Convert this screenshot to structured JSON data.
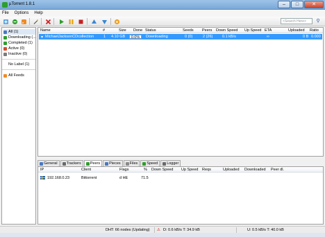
{
  "window": {
    "title": "µTorrent 1.8.1",
    "minimize": "–",
    "maximize": "□",
    "close": "✕"
  },
  "menu": [
    "File",
    "Options",
    "Help"
  ],
  "search": {
    "placeholder": "<Search Here>",
    "button": "⚲"
  },
  "sidebar": {
    "categories": [
      {
        "label": "All (1)",
        "color": "#4a78c2"
      },
      {
        "label": "Downloading (...",
        "color": "#2e9e2e"
      },
      {
        "label": "Completed (1)",
        "color": "#2e9e2e"
      },
      {
        "label": "Active (0)",
        "color": "#d84a28"
      },
      {
        "label": "Inactive (0)",
        "color": "#7a7a7a"
      }
    ],
    "no_label": "No Label (1)",
    "feeds": "All Feeds"
  },
  "torrent_list": {
    "columns": [
      "Name",
      "#",
      "Size",
      "Done",
      "Status",
      "Seeds",
      "Peers",
      "Down Speed",
      "Up Speed",
      "ETA",
      "Uploaded",
      "Ratio"
    ],
    "rows": [
      {
        "name": "MichaelJacksonCDcollection",
        "number": "1",
        "size": "4.10 GB",
        "done": "0.0%",
        "done_fraction": 0.0,
        "status": "Downloading",
        "seeds": "0 (0)",
        "peers": "2 (26)",
        "down_speed": "0.1 kB/s",
        "up_speed": "",
        "eta": "∞",
        "uploaded": "0 B",
        "ratio": "0.000"
      }
    ]
  },
  "detail_tabs": [
    {
      "label": "General",
      "color": "#4a78c2",
      "active": false
    },
    {
      "label": "Trackers",
      "color": "#6a6a6a",
      "active": false
    },
    {
      "label": "Peers",
      "color": "#2e9e2e",
      "active": true
    },
    {
      "label": "Pieces",
      "color": "#4a78c2",
      "active": false
    },
    {
      "label": "Files",
      "color": "#8a8a8a",
      "active": false
    },
    {
      "label": "Speed",
      "color": "#2e9e2e",
      "active": false
    },
    {
      "label": "Logger",
      "color": "#6a6a6a",
      "active": false
    }
  ],
  "peers_list": {
    "columns": [
      "IP",
      "Client",
      "Flags",
      "%",
      "Down Speed",
      "Up Speed",
      "Reqs",
      "Uploaded",
      "Downloaded",
      "Peer dl."
    ],
    "rows": [
      {
        "ip": "192.168.0.23",
        "client": "Bittorrent",
        "flags": "d HE",
        "percent": "71.5"
      }
    ]
  },
  "statusbar": {
    "dht": "DHT: 66 nodes (Updating)",
    "down": "D: 0.6 kB/s T: 34.9 kB",
    "up": "U: 0.5 kB/s T: 40.0 kB"
  }
}
